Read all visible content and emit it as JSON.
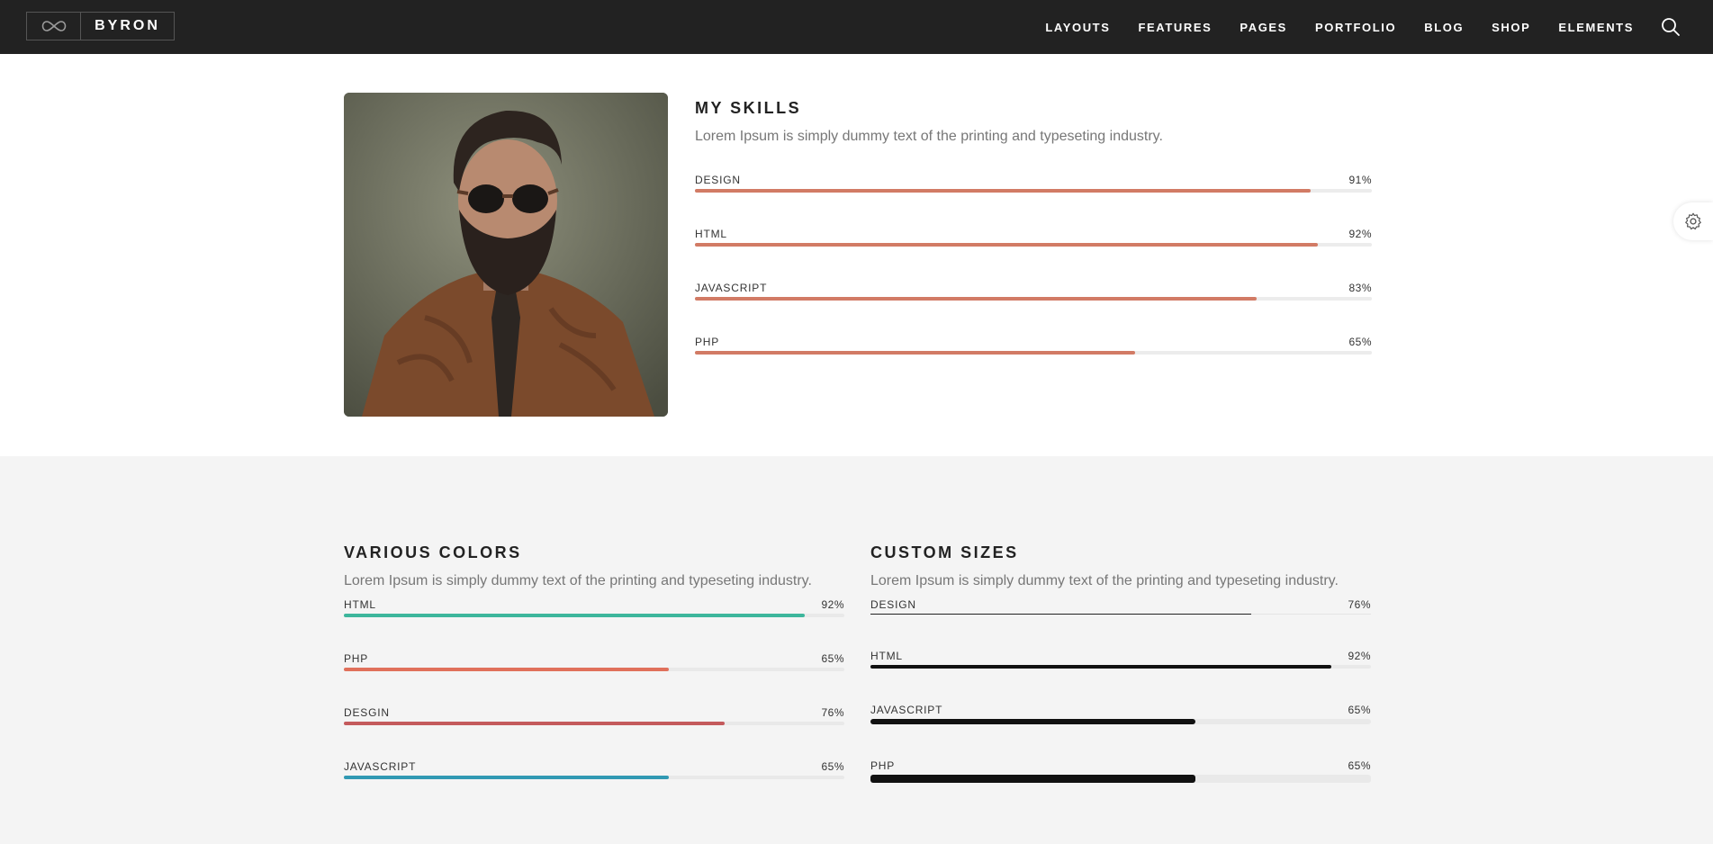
{
  "brand": {
    "name": "BYRON"
  },
  "nav": {
    "items": [
      "LAYOUTS",
      "FEATURES",
      "PAGES",
      "PORTFOLIO",
      "BLOG",
      "SHOP",
      "ELEMENTS"
    ]
  },
  "skills": {
    "title": "MY SKILLS",
    "text": "Lorem Ipsum is simply dummy text of the printing and typeseting industry.",
    "bars": [
      {
        "label": "DESIGN",
        "value": "91%",
        "fraction": 0.91,
        "color": "#d27b65"
      },
      {
        "label": "HTML",
        "value": "92%",
        "fraction": 0.92,
        "color": "#d27b65"
      },
      {
        "label": "JAVASCRIPT",
        "value": "83%",
        "fraction": 0.83,
        "color": "#d27b65"
      },
      {
        "label": "PHP",
        "value": "65%",
        "fraction": 0.65,
        "color": "#d27b65"
      }
    ]
  },
  "colors": {
    "title": "VARIOUS COLORS",
    "text": "Lorem Ipsum is simply dummy text of the printing and typeseting industry.",
    "bars": [
      {
        "label": "HTML",
        "value": "92%",
        "fraction": 0.92,
        "color": "#3db69c"
      },
      {
        "label": "PHP",
        "value": "65%",
        "fraction": 0.65,
        "color": "#e0705b"
      },
      {
        "label": "DESGIN",
        "value": "76%",
        "fraction": 0.76,
        "color": "#c45a5c"
      },
      {
        "label": "JAVASCRIPT",
        "value": "65%",
        "fraction": 0.65,
        "color": "#3199b3"
      }
    ]
  },
  "sizes": {
    "title": "CUSTOM SIZES",
    "text": "Lorem Ipsum is simply dummy text of the printing and typeseting industry.",
    "bars": [
      {
        "label": "DESIGN",
        "value": "76%",
        "fraction": 0.76,
        "color": "#222222",
        "thickness": "thin"
      },
      {
        "label": "HTML",
        "value": "92%",
        "fraction": 0.92,
        "color": "#111111",
        "thickness": "medium"
      },
      {
        "label": "JAVASCRIPT",
        "value": "65%",
        "fraction": 0.65,
        "color": "#111111",
        "thickness": "thick"
      },
      {
        "label": "PHP",
        "value": "65%",
        "fraction": 0.65,
        "color": "#111111",
        "thickness": "extra-thick"
      }
    ]
  },
  "icons": {
    "logo": "infinity-icon",
    "search": "search-icon",
    "settings": "gear-icon"
  }
}
